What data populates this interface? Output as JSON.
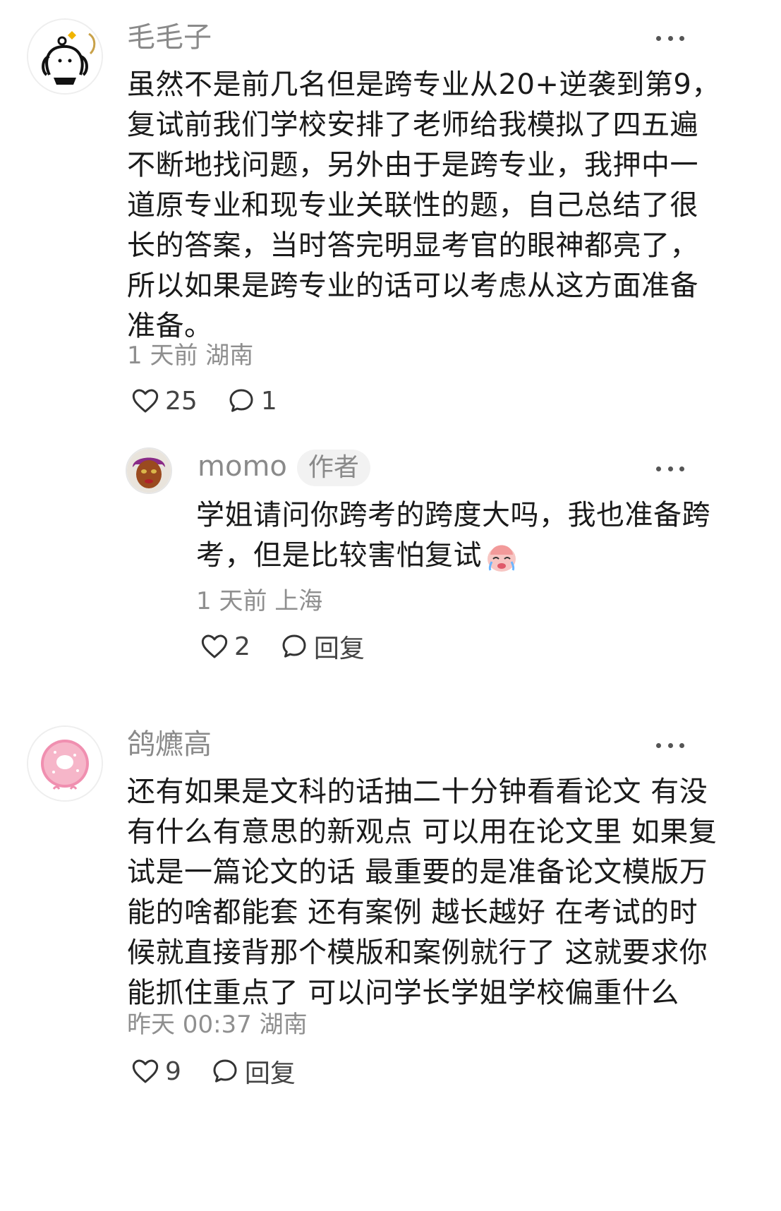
{
  "comments": [
    {
      "username": "毛毛子",
      "text_lines": [
        "虽然不是前几名但是跨专业从20+逆袭到第9，",
        "复试前我们学校安排了老师给我模拟了四五遍",
        "不断地找问题，另外由于是跨专业，我押中一",
        "道原专业和现专业关联性的题，自己总结了很",
        "长的答案，当时答完明显考官的眼神都亮了，",
        "所以如果是跨专业的话可以考虑从这方面准备",
        "准备。"
      ],
      "meta": "1 天前 湖南",
      "likes": "25",
      "replies": "1",
      "avatar_icon": "cartoon-dog-avatar-icon"
    },
    {
      "username": "momo",
      "badge": "作者",
      "text_lines": [
        "学姐请问你跨考的跨度大吗，我也准备跨",
        "考，但是比较害怕复试"
      ],
      "emoji_icon": "crying-face-emoji-icon",
      "meta": "1 天前 上海",
      "likes": "2",
      "reply_label": "回复",
      "avatar_icon": "portrait-avatar-icon"
    },
    {
      "username": "鸽爊高",
      "text_lines": [
        "还有如果是文科的话抽二十分钟看看论文 有没",
        "有什么有意思的新观点 可以用在论文里 如果复",
        "试是一篇论文的话 最重要的是准备论文模版万",
        "能的啥都能套 还有案例 越长越好 在考试的时",
        "候就直接背那个模版和案例就行了 这就要求你",
        "能抓住重点了 可以问学长学姐学校偏重什么"
      ],
      "meta": "昨天 00:37 湖南",
      "likes": "9",
      "reply_label": "回复",
      "avatar_icon": "pink-donut-avatar-icon"
    }
  ],
  "colors": {
    "text": "#1a1a1a",
    "muted": "#8a8a8a",
    "badge_bg": "#f2f2f2"
  }
}
